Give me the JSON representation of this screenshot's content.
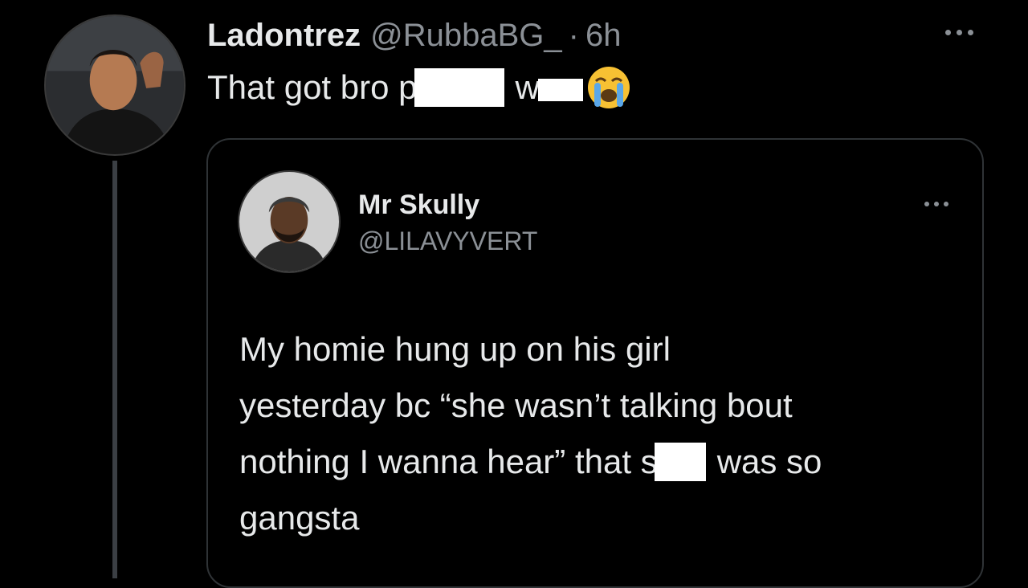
{
  "tweet": {
    "display_name": "Ladontrez",
    "handle": "@RubbaBG_",
    "separator": "·",
    "time": "6h",
    "more_icon": "more-horizontal-icon",
    "text_part1": "That got bro p",
    "text_part2": "w",
    "emoji": "loudly-crying-face-emoji"
  },
  "quoted_tweet": {
    "display_name": "Mr Skully",
    "handle": "@LILAVYVERT",
    "more_icon": "more-horizontal-icon",
    "body_line1": "My homie hung up on his girl",
    "body_line2": "yesterday bc “she wasn’t talking bout",
    "body_line3a": "nothing I wanna hear” that s",
    "body_line3b": "was so",
    "body_line4": "gangsta"
  },
  "colors": {
    "background": "#000000",
    "text_primary": "#e7e9ea",
    "text_secondary": "#8b9096",
    "border": "#2f3336",
    "redaction": "#ffffff"
  }
}
